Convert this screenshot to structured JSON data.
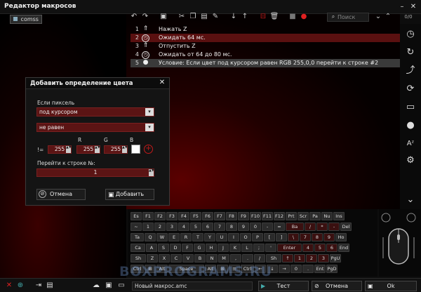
{
  "window": {
    "title": "Редактор макросов",
    "btn_min": "–",
    "btn_close": "✕"
  },
  "tree": {
    "item": "comss"
  },
  "toolbar": {
    "search_placeholder": "Поиск",
    "counter": "0/0"
  },
  "macro_rows": [
    {
      "num": "1",
      "icon": "arrow-up",
      "text": "Нажать Z"
    },
    {
      "num": "2",
      "icon": "clock",
      "text": "Ожидать 64 мс."
    },
    {
      "num": "3",
      "icon": "arrow-up",
      "text": "Отпустить Z"
    },
    {
      "num": "4",
      "icon": "clock",
      "text": "Ожидать от 64 до 80 мс."
    },
    {
      "num": "5",
      "icon": "drop",
      "text": "Условие: Если цвет под курсором равен RGB 255,0,0 перейти к строке #2"
    }
  ],
  "dialog": {
    "title": "Добавить определение цвета",
    "close": "✕",
    "pixel_label": "Если пиксель",
    "pixel_value": "под курсором",
    "cond_value": "не равен",
    "r_label": "R",
    "g_label": "G",
    "b_label": "B",
    "op_label": "!=",
    "r_value": "255",
    "g_value": "255",
    "b_value": "255",
    "goto_label": "Перейти к строке №:",
    "goto_value": "1",
    "cancel": "Отмена",
    "add": "Добавить"
  },
  "keyboard": {
    "row1": [
      "Es",
      "F1",
      "F2",
      "F3",
      "F4",
      "F5",
      "F6",
      "F7",
      "F8",
      "F9",
      "F10",
      "F11",
      "F12",
      "Prt",
      "Scr",
      "Pa",
      "Nu",
      "Ins"
    ],
    "row2": [
      "~",
      "1",
      "2",
      "3",
      "4",
      "5",
      "6",
      "7",
      "8",
      "9",
      "0",
      "-",
      "=",
      "Ba",
      "/",
      "*",
      "-",
      "Del"
    ],
    "row3": [
      "Ta",
      "Q",
      "W",
      "E",
      "R",
      "T",
      "Y",
      "U",
      "I",
      "O",
      "P",
      "[",
      "]",
      "\\",
      "7",
      "8",
      "9",
      "Ho"
    ],
    "row4": [
      "Ca",
      "A",
      "S",
      "D",
      "F",
      "G",
      "H",
      "J",
      "K",
      "L",
      ";",
      "'",
      "Enter",
      "4",
      "5",
      "6",
      "End"
    ],
    "row5": [
      "Sh",
      "Z",
      "X",
      "C",
      "V",
      "B",
      "N",
      "M",
      ",",
      ".",
      "/",
      "Sh",
      "↑",
      "1",
      "2",
      "3",
      "PgU"
    ],
    "row6": [
      "Ctrl",
      "⊞",
      "Alt",
      "Space",
      "Alt",
      "⊞",
      "≡",
      "Ctrl",
      "←",
      "↓",
      "→",
      "0",
      ".",
      "Ent",
      "PgD"
    ]
  },
  "bottom": {
    "macro_name": "Новый макрос.amc",
    "test": "Тест",
    "cancel": "Отмена",
    "ok": "Ok",
    "watermark": "BOXPROGRAMS.RU"
  },
  "colors": {
    "accent": "#c41a1a",
    "selection": "#5a1010"
  }
}
